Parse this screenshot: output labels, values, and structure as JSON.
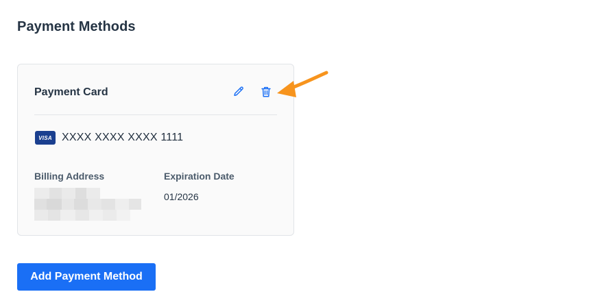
{
  "page": {
    "title": "Payment Methods"
  },
  "card": {
    "title": "Payment Card",
    "brand": "VISA",
    "number": "XXXX XXXX XXXX 1111",
    "billing_label": "Billing Address",
    "expiry_label": "Expiration Date",
    "expiry_value": "01/2026",
    "actions": {
      "edit_icon": "pencil-icon",
      "delete_icon": "trash-icon"
    }
  },
  "add_button": {
    "label": "Add Payment Method"
  },
  "colors": {
    "accent": "#1a6ff5",
    "icon": "#1a6ff5",
    "visa": "#1a3f8f",
    "annotation_arrow": "#f7941d",
    "title": "#253444"
  }
}
